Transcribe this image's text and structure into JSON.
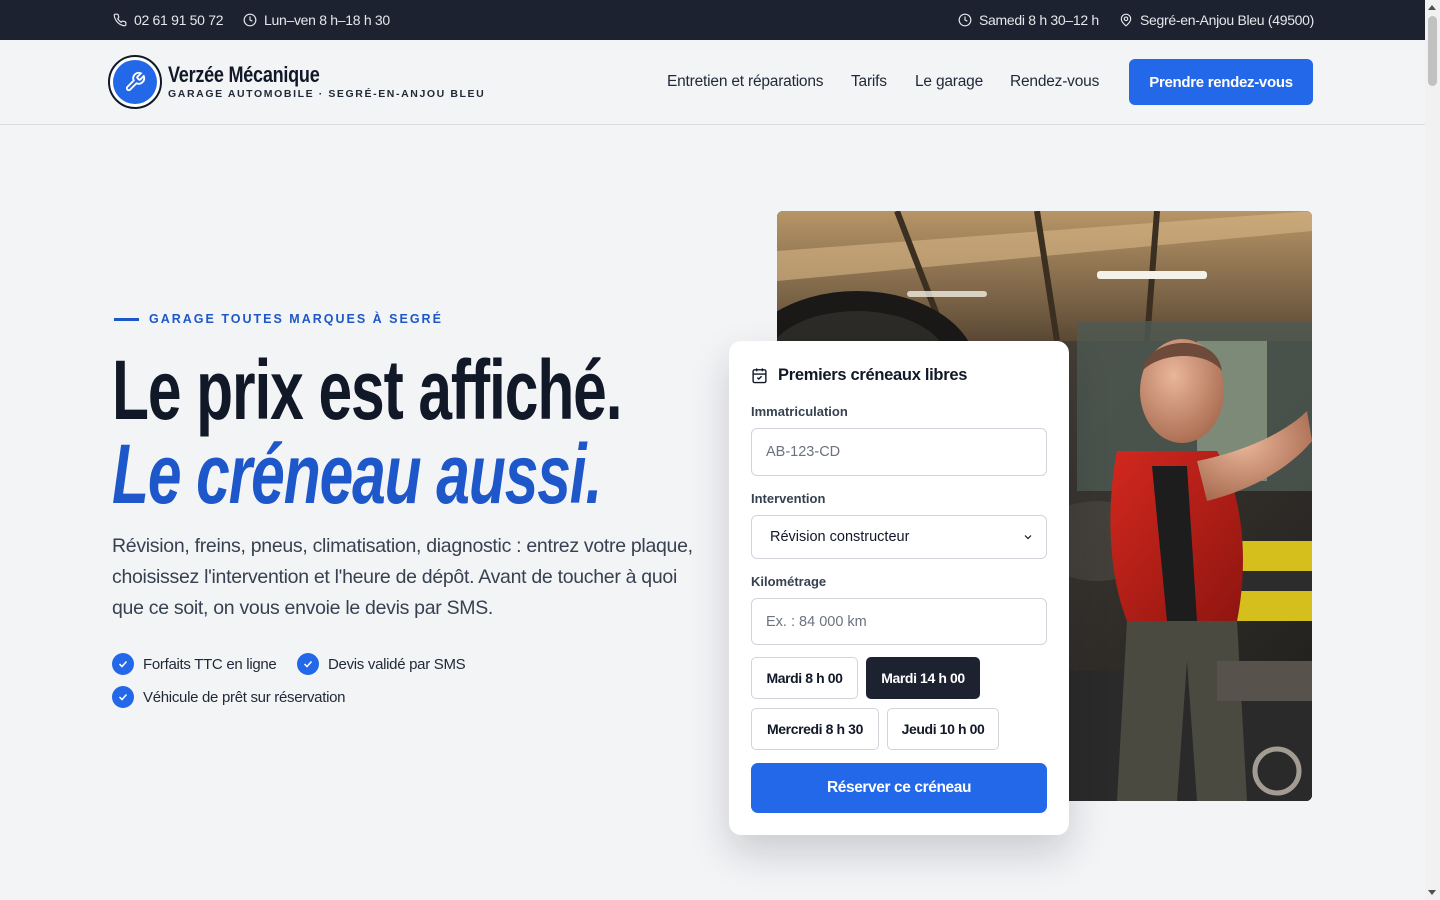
{
  "topbar": {
    "phone": "02 61 91 50 72",
    "hours_week": "Lun–ven 8 h–18 h 30",
    "hours_saturday": "Samedi 8 h 30–12 h",
    "location": "Segré-en-Anjou Bleu (49500)"
  },
  "header": {
    "brand_name": "Verzée Mécanique",
    "brand_tagline": "GARAGE AUTOMOBILE · SEGRÉ-EN-ANJOU BLEU",
    "nav": [
      "Entretien et réparations",
      "Tarifs",
      "Le garage",
      "Rendez-vous"
    ],
    "cta_label": "Prendre rendez-vous"
  },
  "hero": {
    "eyebrow": "GARAGE TOUTES MARQUES À SEGRÉ",
    "title_line1": "Le prix est affiché.",
    "title_line2": "Le créneau aussi.",
    "lead": "Révision, freins, pneus, climatisation, diagnostic : entrez votre plaque, choisissez l'intervention et l'heure de dépôt. Avant de toucher à quoi que ce soit, on vous envoie le devis par SMS.",
    "checks": [
      "Forfaits TTC en ligne",
      "Devis validé par SMS",
      "Véhicule de prêt sur réservation"
    ]
  },
  "booking": {
    "title": "Premiers créneaux libres",
    "plate_label": "Immatriculation",
    "plate_placeholder": "AB-123-CD",
    "service_label": "Intervention",
    "service_value": "Révision constructeur",
    "mileage_label": "Kilométrage",
    "mileage_placeholder": "Ex. : 84 000 km",
    "slots": [
      "Mardi 8 h 00",
      "Mardi 14 h 00",
      "Mercredi 8 h 30",
      "Jeudi 10 h 00"
    ],
    "selected_slot": "Mardi 14 h 00",
    "submit_label": "Réserver ce créneau"
  },
  "colors": {
    "accent": "#2368e8",
    "accent_text": "#1d57c9",
    "dark": "#1c2230",
    "background": "#f3f4f6"
  }
}
